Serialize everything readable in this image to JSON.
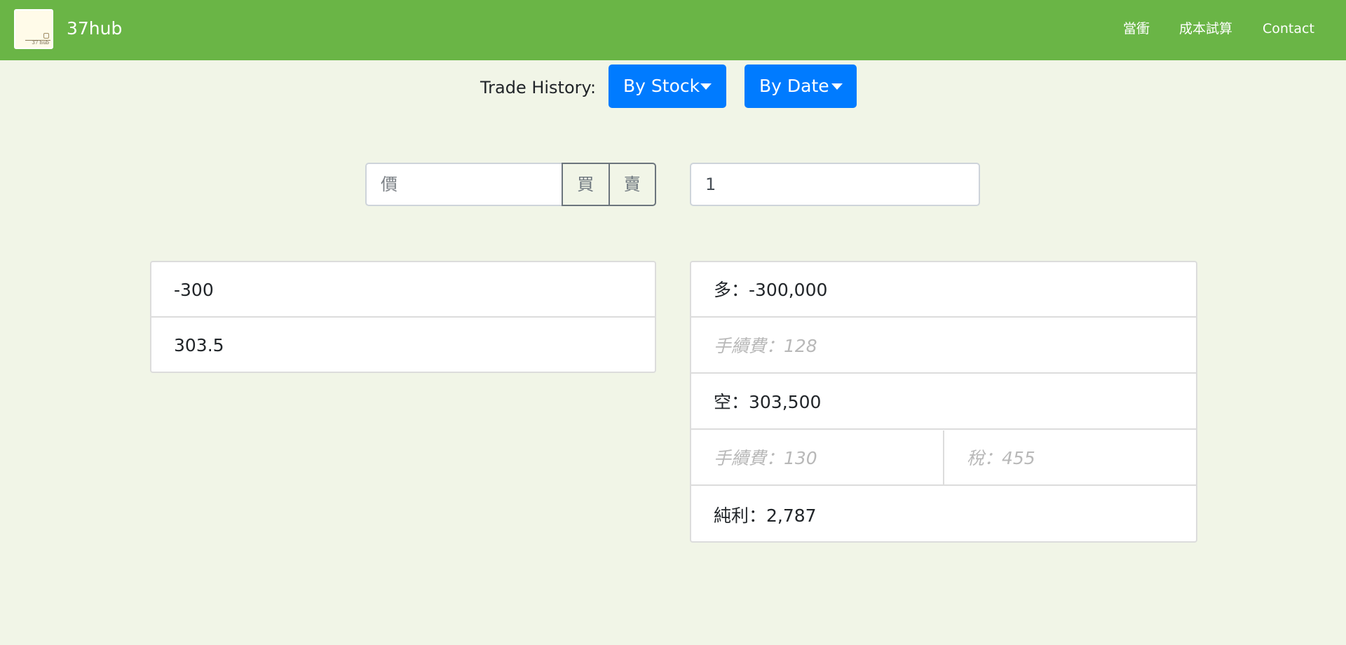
{
  "navbar": {
    "brand": "37hub",
    "logo_text": "37 hub",
    "links": [
      "當衝",
      "成本試算",
      "Contact"
    ],
    "color": "#6ab546"
  },
  "trade_history": {
    "label": "Trade History:",
    "by_stock": "By Stock",
    "by_date": "By Date",
    "button_color": "#007bff"
  },
  "form": {
    "price_placeholder": "價",
    "buy_label": "買",
    "sell_label": "賣",
    "quantity_value": "1"
  },
  "results_left": {
    "diff": "-300",
    "price": "303.5"
  },
  "results_right": {
    "long": "多：-300,000",
    "long_fee": "手續費：128",
    "short": "空：303,500",
    "short_fee": "手續費：130",
    "tax": "稅：455",
    "net_profit": "純利：2,787"
  },
  "icons": {
    "dropdown": "caret-down-icon"
  }
}
